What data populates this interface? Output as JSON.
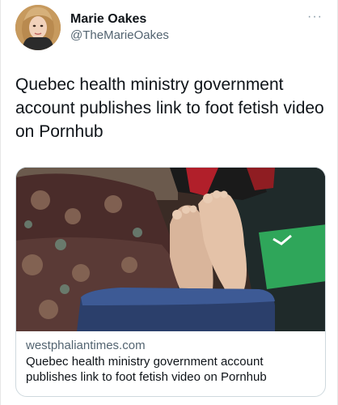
{
  "user": {
    "display_name": "Marie Oakes",
    "handle": "@TheMarieOakes"
  },
  "more_label": "···",
  "tweet": {
    "text": "Quebec health ministry government account publishes link to foot fetish video on Pornhub"
  },
  "card": {
    "domain": "westphaliantimes.com",
    "title": "Quebec health ministry government account publishes link to foot fetish video on Pornhub"
  },
  "icons": {
    "more": "more-icon"
  },
  "colors": {
    "text": "#0f1419",
    "secondary": "#536471",
    "border": "#cfd9de"
  }
}
